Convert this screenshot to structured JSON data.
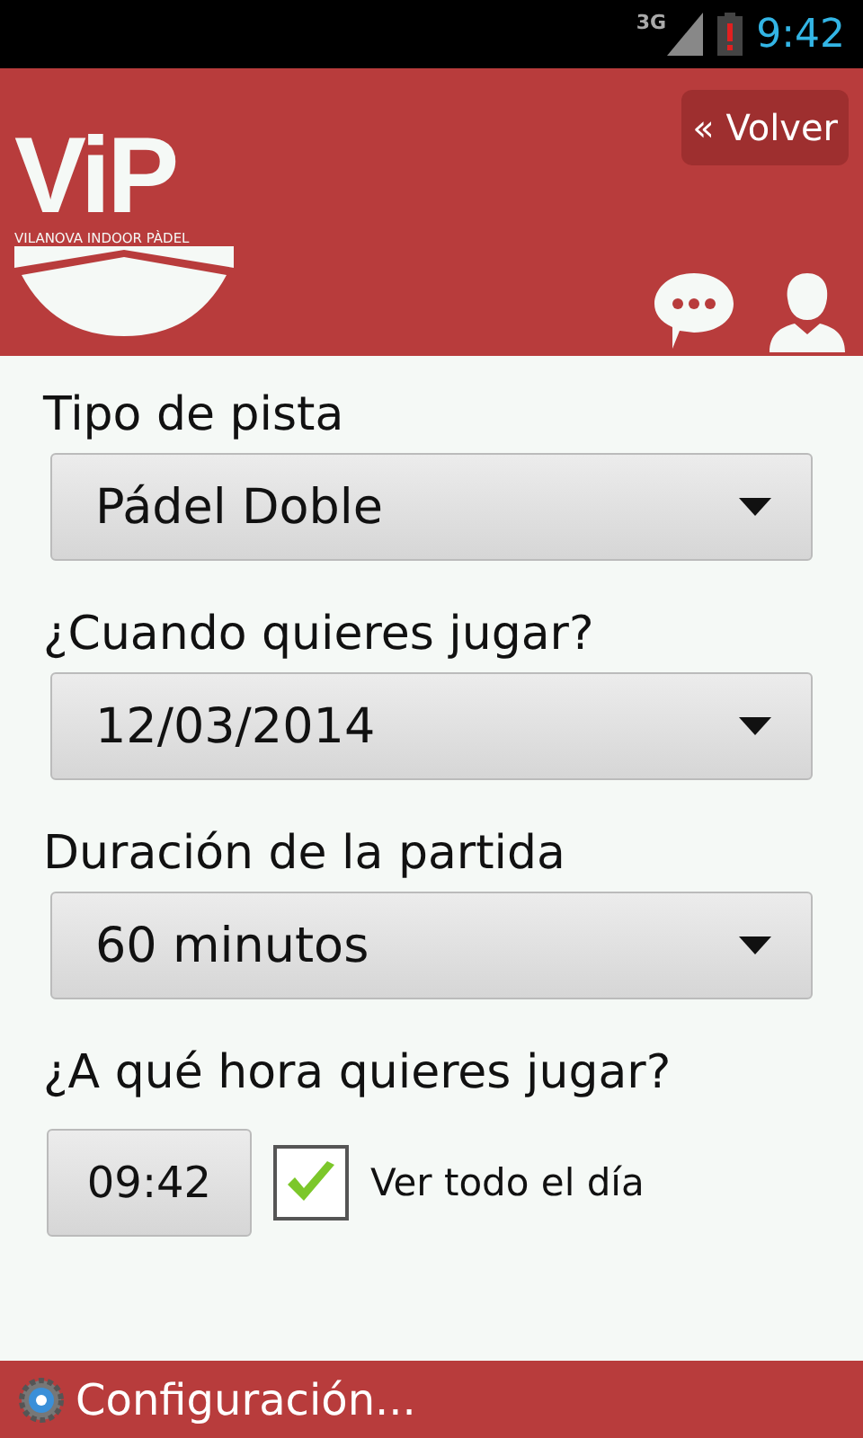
{
  "status_bar": {
    "network": "3G",
    "time": "9:42"
  },
  "header": {
    "logo": {
      "letters": "ViP",
      "tagline": "VILANOVA INDOOR PÀDEL"
    },
    "back_button": "« Volver"
  },
  "form": [
    {
      "label": "Tipo de pista",
      "kind": "dropdown",
      "value": "Pádel Doble"
    },
    {
      "label": "¿Cuando quieres jugar?",
      "kind": "dropdown",
      "value": "12/03/2014"
    },
    {
      "label": "Duración de la partida",
      "kind": "dropdown",
      "value": "60 minutos"
    },
    {
      "label": "¿A qué hora quieres jugar?",
      "kind": "time",
      "value": "09:42",
      "checkbox": {
        "label": "Ver todo el día",
        "checked": true
      }
    }
  ],
  "footer": {
    "label": "Configuración..."
  }
}
